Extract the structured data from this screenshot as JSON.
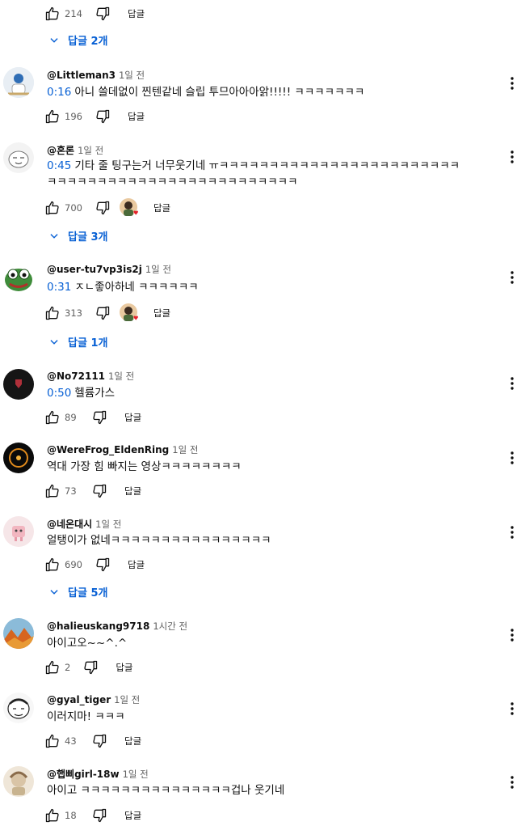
{
  "top": {
    "likes": "214",
    "reply_label": "답글",
    "replies_label": "답글 2개"
  },
  "comments": [
    {
      "author": "@Littleman3",
      "time": "1일 전",
      "timestamp": "0:16",
      "lines": [
        "아니 쓸데없이 찐텐같네 슬립 투므아아아앍!!!!! ㅋㅋㅋㅋㅋㅋㅋ"
      ],
      "likes": "196",
      "reply_label": "답글"
    },
    {
      "author": "@혼론",
      "time": "1일 전",
      "timestamp": "0:45",
      "lines": [
        "기타 줄 팅구는거 너무웃기네 ㅠㅋㅋㅋㅋㅋㅋㅋㅋㅋㅋㅋㅋㅋㅋㅋㅋㅋㅋㅋㅋㅋㅋㅋㅋ",
        "ㅋㅋㅋㅋㅋㅋㅋㅋㅋㅋㅋㅋㅋㅋㅋㅋㅋㅋㅋㅋㅋㅋㅋㅋㅋ"
      ],
      "likes": "700",
      "reply_label": "답글",
      "replies_label": "답글 3개"
    },
    {
      "author": "@user-tu7vp3is2j",
      "time": "1일 전",
      "timestamp": "0:31",
      "lines": [
        "ㅈㄴ좋아하네 ㅋㅋㅋㅋㅋㅋ"
      ],
      "likes": "313",
      "reply_label": "답글",
      "replies_label": "답글 1개"
    },
    {
      "author": "@No72111",
      "time": "1일 전",
      "timestamp": "0:50",
      "lines": [
        "헬륨가스"
      ],
      "likes": "89",
      "reply_label": "답글"
    },
    {
      "author": "@WereFrog_EldenRing",
      "time": "1일 전",
      "timestamp": "",
      "lines": [
        "역대 가장 힘 빠지는 영상ㅋㅋㅋㅋㅋㅋㅋㅋ"
      ],
      "likes": "73",
      "reply_label": "답글"
    },
    {
      "author": "@네온대시",
      "time": "1일 전",
      "timestamp": "",
      "lines": [
        "얼탱이가 없네ㅋㅋㅋㅋㅋㅋㅋㅋㅋㅋㅋㅋㅋㅋㅋㅋ"
      ],
      "likes": "690",
      "reply_label": "답글",
      "replies_label": "답글 5개"
    },
    {
      "author": "@halieuskang9718",
      "time": "1시간 전",
      "timestamp": "",
      "lines": [
        "아이고오~~^.^"
      ],
      "likes": "2",
      "reply_label": "답글"
    },
    {
      "author": "@gyal_tiger",
      "time": "1일 전",
      "timestamp": "",
      "lines": [
        "이러지마! ㅋㅋㅋ"
      ],
      "likes": "43",
      "reply_label": "답글"
    },
    {
      "author": "@햅삐girl-18w",
      "time": "1일 전",
      "timestamp": "",
      "lines": [
        "아이고 ㅋㅋㅋㅋㅋㅋㅋㅋㅋㅋㅋㅋㅋㅋㅋ겁나 웃기네"
      ],
      "likes": "18",
      "reply_label": "답글"
    }
  ],
  "colors": {
    "link_blue": "#065fd4",
    "secondary_text": "#606060",
    "heart_red": "#e5202b"
  }
}
